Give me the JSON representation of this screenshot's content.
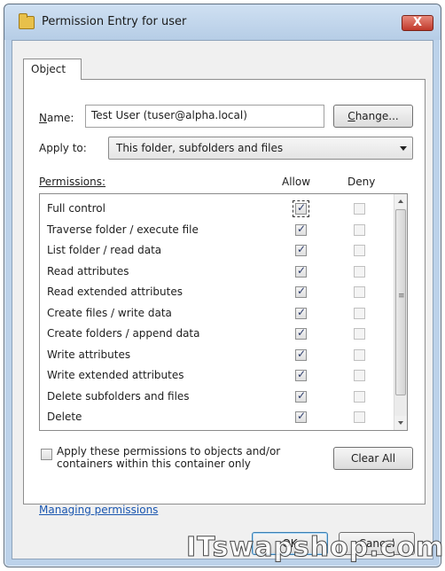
{
  "window": {
    "title": "Permission Entry for user",
    "close_label": "X"
  },
  "tabs": [
    {
      "label": "Object"
    }
  ],
  "name_field": {
    "label_prefix": "N",
    "label_rest": "ame:",
    "value": "Test User (tuser@alpha.local)",
    "change_button_prefix": "C",
    "change_button_rest": "hange..."
  },
  "apply_to": {
    "label": "Apply to:",
    "selected": "This folder, subfolders and files"
  },
  "permissions": {
    "header_label": "Permissions:",
    "allow_header": "Allow",
    "deny_header": "Deny",
    "items": [
      {
        "label": "Full control",
        "allow": true,
        "deny": false
      },
      {
        "label": "Traverse folder / execute file",
        "allow": true,
        "deny": false
      },
      {
        "label": "List folder / read data",
        "allow": true,
        "deny": false
      },
      {
        "label": "Read attributes",
        "allow": true,
        "deny": false
      },
      {
        "label": "Read extended attributes",
        "allow": true,
        "deny": false
      },
      {
        "label": "Create files / write data",
        "allow": true,
        "deny": false
      },
      {
        "label": "Create folders / append data",
        "allow": true,
        "deny": false
      },
      {
        "label": "Write attributes",
        "allow": true,
        "deny": false
      },
      {
        "label": "Write extended attributes",
        "allow": true,
        "deny": false
      },
      {
        "label": "Delete subfolders and files",
        "allow": true,
        "deny": false
      },
      {
        "label": "Delete",
        "allow": true,
        "deny": false
      }
    ]
  },
  "apply_inherit": {
    "label_line1": "Apply these permissions to objects and/or",
    "label_line2": "containers within this container only",
    "checked": false
  },
  "clear_all_label": "Clear All",
  "managing_link": "Managing permissions",
  "footer": {
    "ok_label": "OK",
    "cancel_label": "Cancel"
  },
  "watermark": "ITswapshop.com",
  "colors": {
    "window_frame": "#bcd2ea",
    "close_button": "#c0392b",
    "link": "#1a56b0",
    "check": "#2a3a6a"
  }
}
